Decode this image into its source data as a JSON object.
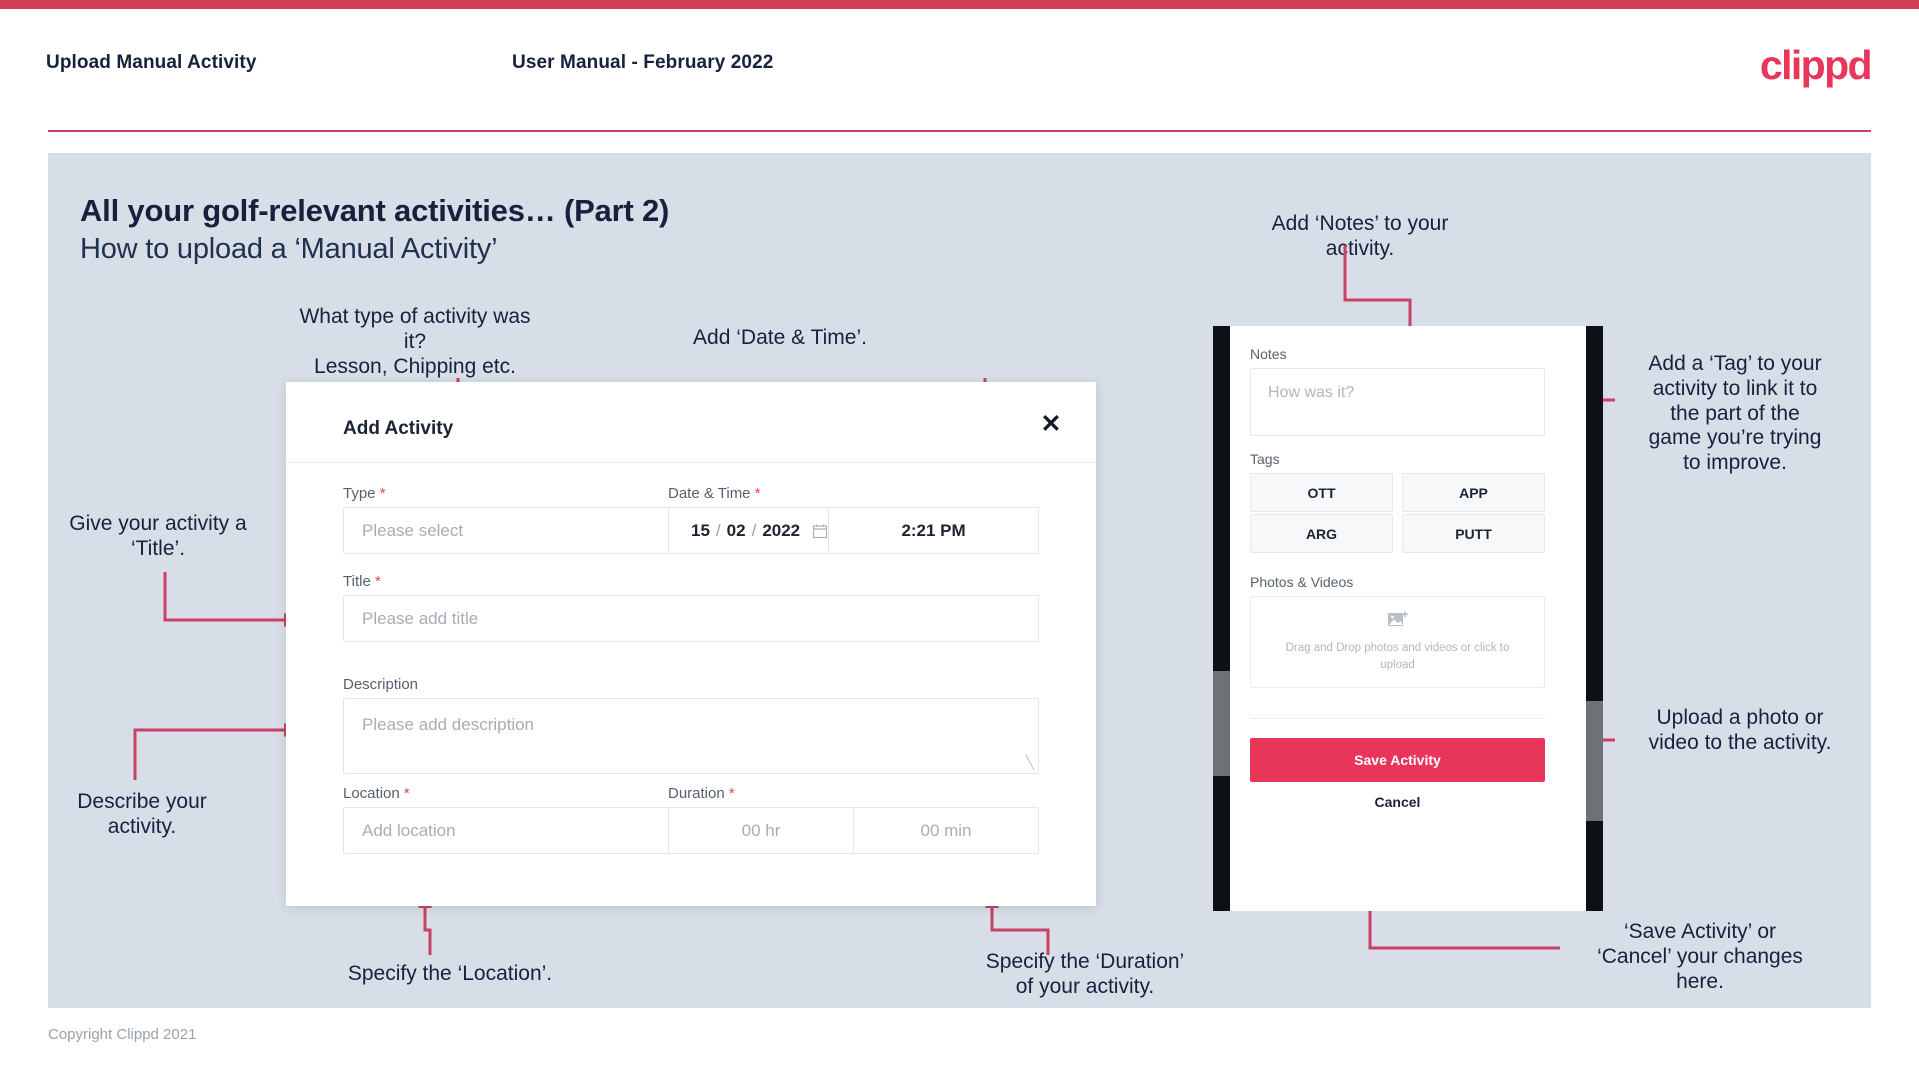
{
  "header": {
    "title": "Upload Manual Activity",
    "subtitle": "User Manual - February 2022",
    "brand": "clippd"
  },
  "slide": {
    "title": "All your golf-relevant activities… (Part 2)",
    "subtitle": "How to upload a ‘Manual Activity’",
    "copyright": "Copyright Clippd 2021"
  },
  "annotations": {
    "type": "What type of activity was it?\nLesson, Chipping etc.",
    "date_time": "Add ‘Date & Time’.",
    "title": "Give your activity a\n‘Title’.",
    "description": "Describe your\nactivity.",
    "location": "Specify the ‘Location’.",
    "duration": "Specify the ‘Duration’\nof your activity.",
    "notes": "Add ‘Notes’ to your\nactivity.",
    "tags": "Add a ‘Tag’ to your\nactivity to link it to\nthe part of the\ngame you’re trying\nto improve.",
    "upload": "Upload a photo or\nvideo to the activity.",
    "save_cancel": "‘Save Activity’ or\n‘Cancel’ your changes\nhere."
  },
  "dialog": {
    "title": "Add Activity",
    "close_icon": "close-icon",
    "fields": {
      "type": {
        "label": "Type",
        "required": "*",
        "placeholder": "Please select",
        "icon": "chevron-down-icon"
      },
      "datetime": {
        "label": "Date & Time",
        "required": "*",
        "day": "15",
        "month": "02",
        "year": "2022",
        "separator": "/",
        "time": "2:21 PM",
        "icon": "calendar-icon"
      },
      "title": {
        "label": "Title",
        "required": "*",
        "placeholder": "Please add title"
      },
      "description": {
        "label": "Description",
        "required": "",
        "placeholder": "Please add description"
      },
      "location": {
        "label": "Location",
        "required": "*",
        "placeholder": "Add location"
      },
      "duration": {
        "label": "Duration",
        "required": "*",
        "hours_placeholder": "00 hr",
        "minutes_placeholder": "00 min"
      }
    }
  },
  "phone": {
    "notes": {
      "label": "Notes",
      "placeholder": "How was it?"
    },
    "tags": {
      "label": "Tags",
      "items": [
        "OTT",
        "APP",
        "ARG",
        "PUTT"
      ]
    },
    "photos": {
      "label": "Photos & Videos",
      "dropzone_text": "Drag and Drop photos and videos or click to upload",
      "icon": "add-image-icon"
    },
    "save_label": "Save Activity",
    "cancel_label": "Cancel"
  },
  "colors": {
    "accent": "#e8355a",
    "bar": "#cf4059",
    "slide_bg": "#d8dee7",
    "text_dark": "#16213e",
    "arrow": "#c94263"
  }
}
